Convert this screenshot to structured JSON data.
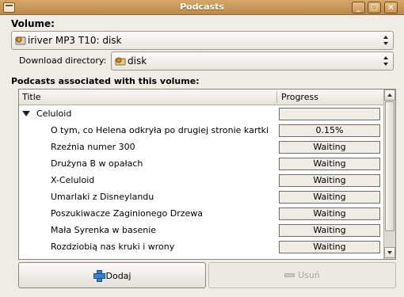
{
  "window": {
    "title": "Podcasts",
    "controls": [
      "minimize",
      "maximize",
      "close"
    ]
  },
  "volume": {
    "label": "Volume:",
    "selected": "iriver MP3 T10: disk",
    "icon": "device-drive-icon"
  },
  "download_directory": {
    "label": "Download directory:",
    "selected": "disk",
    "icon": "folder-drive-icon"
  },
  "podcasts": {
    "section_label": "Podcasts associated with this volume:",
    "columns": [
      "Title",
      "Progress"
    ],
    "group": {
      "name": "Celuloid",
      "expanded": true,
      "progress": ""
    },
    "items": [
      {
        "title": "O tym, co Helena odkryła po drugiej stronie kartki",
        "progress": "0.15%"
      },
      {
        "title": "Rzeźnia numer 300",
        "progress": "Waiting"
      },
      {
        "title": "Drużyna B w opałach",
        "progress": "Waiting"
      },
      {
        "title": "X-Celuloid",
        "progress": "Waiting"
      },
      {
        "title": "Umarlaki z Disneylandu",
        "progress": "Waiting"
      },
      {
        "title": "Poszukiwacze Zaginionego Drzewa",
        "progress": "Waiting"
      },
      {
        "title": "Mała Syrenka w basenie",
        "progress": "Waiting"
      },
      {
        "title": "Rozdziobią nas kruki i wrony",
        "progress": "Waiting"
      }
    ]
  },
  "buttons": {
    "add": {
      "label": "Dodaj",
      "enabled": true
    },
    "remove": {
      "label": "Usuń",
      "enabled": false
    }
  }
}
